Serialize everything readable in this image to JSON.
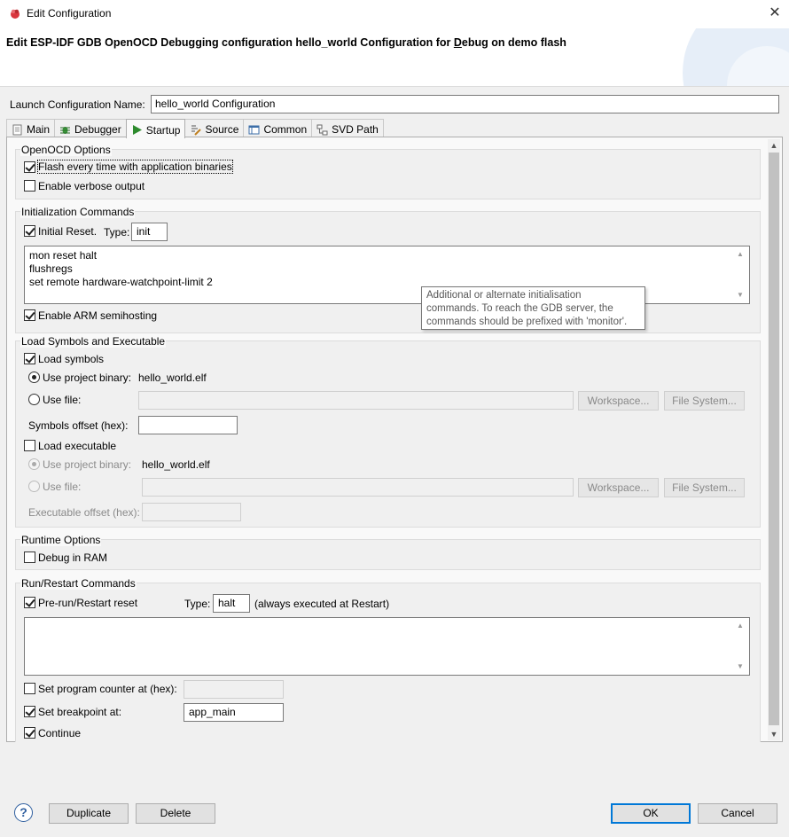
{
  "window": {
    "title": "Edit Configuration",
    "close_label": "✕"
  },
  "header": {
    "title_pre": "Edit ESP-IDF GDB OpenOCD Debugging configuration hello_world Configuration for ",
    "title_mnemonic": "D",
    "title_post": "ebug on demo flash"
  },
  "name_field": {
    "label": "Launch Configuration Name:",
    "value": "hello_world Configuration"
  },
  "tabs": [
    {
      "label": "Main",
      "icon": "main-tab-icon"
    },
    {
      "label": "Debugger",
      "icon": "debugger-tab-icon"
    },
    {
      "label": "Startup",
      "icon": "startup-tab-icon",
      "active": true
    },
    {
      "label": "Source",
      "icon": "source-tab-icon"
    },
    {
      "label": "Common",
      "icon": "common-tab-icon"
    },
    {
      "label": "SVD Path",
      "icon": "svd-path-tab-icon"
    }
  ],
  "openocd": {
    "title": "OpenOCD Options",
    "flash_label": "Flash every time with application binaries",
    "flash_checked": true,
    "verbose_label": "Enable verbose output",
    "verbose_checked": false
  },
  "init": {
    "title": "Initialization Commands",
    "initial_reset_label": "Initial Reset.",
    "type_label": "Type:",
    "type_value": "init",
    "commands": [
      "mon reset halt",
      "flushregs",
      "set remote hardware-watchpoint-limit 2"
    ],
    "semihosting_label": "Enable ARM semihosting"
  },
  "tooltip": {
    "lines": [
      "Additional or alternate initialisation",
      "commands. To reach the GDB server, the",
      "commands should be prefixed with 'monitor'."
    ]
  },
  "load": {
    "title": "Load Symbols and Executable",
    "load_symbols_label": "Load symbols",
    "use_project_label": "Use project binary:",
    "project_binary": "hello_world.elf",
    "use_file_label": "Use file:",
    "workspace_label": "Workspace...",
    "filesystem_label": "File System...",
    "symbols_offset_label": "Symbols offset (hex):",
    "load_exec_label": "Load executable",
    "exec_use_project_label": "Use project binary:",
    "exec_project_binary": "hello_world.elf",
    "exec_use_file_label": "Use file:",
    "exec_offset_label": "Executable offset (hex):"
  },
  "runtime": {
    "title": "Runtime Options",
    "debug_ram_label": "Debug in RAM"
  },
  "run": {
    "title": "Run/Restart Commands",
    "prerun_label": "Pre-run/Restart reset",
    "type_label": "Type:",
    "type_value": "halt",
    "note": "(always executed at Restart)",
    "set_pc_label": "Set program counter at (hex):",
    "set_bp_label": "Set breakpoint at:",
    "bp_value": "app_main",
    "continue_label": "Continue"
  },
  "footer": {
    "help_label": "?",
    "duplicate_label": "Duplicate",
    "delete_label": "Delete",
    "ok_label": "OK",
    "cancel_label": "Cancel"
  },
  "colors": {
    "accent": "#0078d7",
    "tab_icon_green": "#2e8b2e"
  }
}
